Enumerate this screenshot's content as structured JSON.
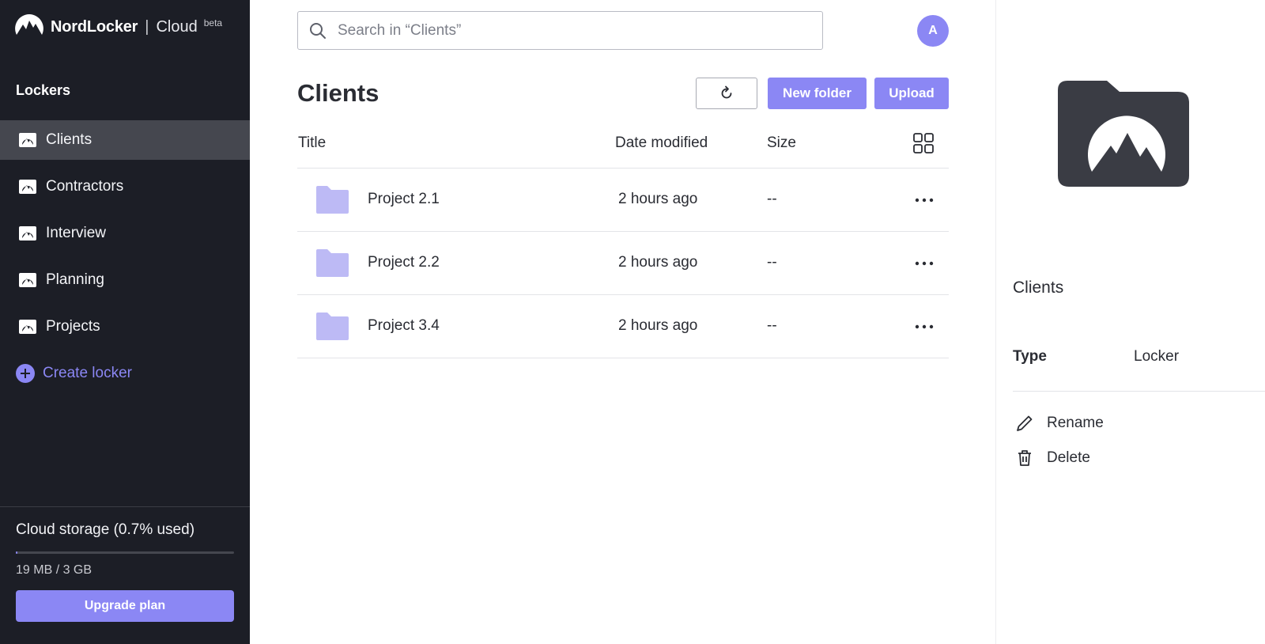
{
  "brand": {
    "name": "NordLocker",
    "separator": "|",
    "product": "Cloud",
    "badge": "beta"
  },
  "sidebar": {
    "section_title": "Lockers",
    "items": [
      {
        "label": "Clients",
        "active": true
      },
      {
        "label": "Contractors",
        "active": false
      },
      {
        "label": "Interview",
        "active": false
      },
      {
        "label": "Planning",
        "active": false
      },
      {
        "label": "Projects",
        "active": false
      }
    ],
    "create_label": "Create locker",
    "storage": {
      "title": "Cloud storage (0.7% used)",
      "used_fraction": 0.007,
      "used_text": "19 MB / 3 GB",
      "upgrade_label": "Upgrade plan"
    }
  },
  "header": {
    "search_placeholder": "Search in “Clients”",
    "avatar_initial": "A"
  },
  "main": {
    "title": "Clients",
    "new_folder_label": "New folder",
    "upload_label": "Upload",
    "columns": {
      "title": "Title",
      "date": "Date modified",
      "size": "Size"
    },
    "rows": [
      {
        "title": "Project 2.1",
        "date": "2 hours ago",
        "size": "--"
      },
      {
        "title": "Project 2.2",
        "date": "2 hours ago",
        "size": "--"
      },
      {
        "title": "Project 3.4",
        "date": "2 hours ago",
        "size": "--"
      }
    ]
  },
  "details": {
    "name": "Clients",
    "type_label": "Type",
    "type_value": "Locker",
    "rename_label": "Rename",
    "delete_label": "Delete"
  },
  "colors": {
    "accent": "#8b87f4",
    "sidebar_bg": "#1c1e26",
    "active_item_bg": "#45474f",
    "folder": "#bdbaf5",
    "locker_icon": "#3a3c44"
  }
}
